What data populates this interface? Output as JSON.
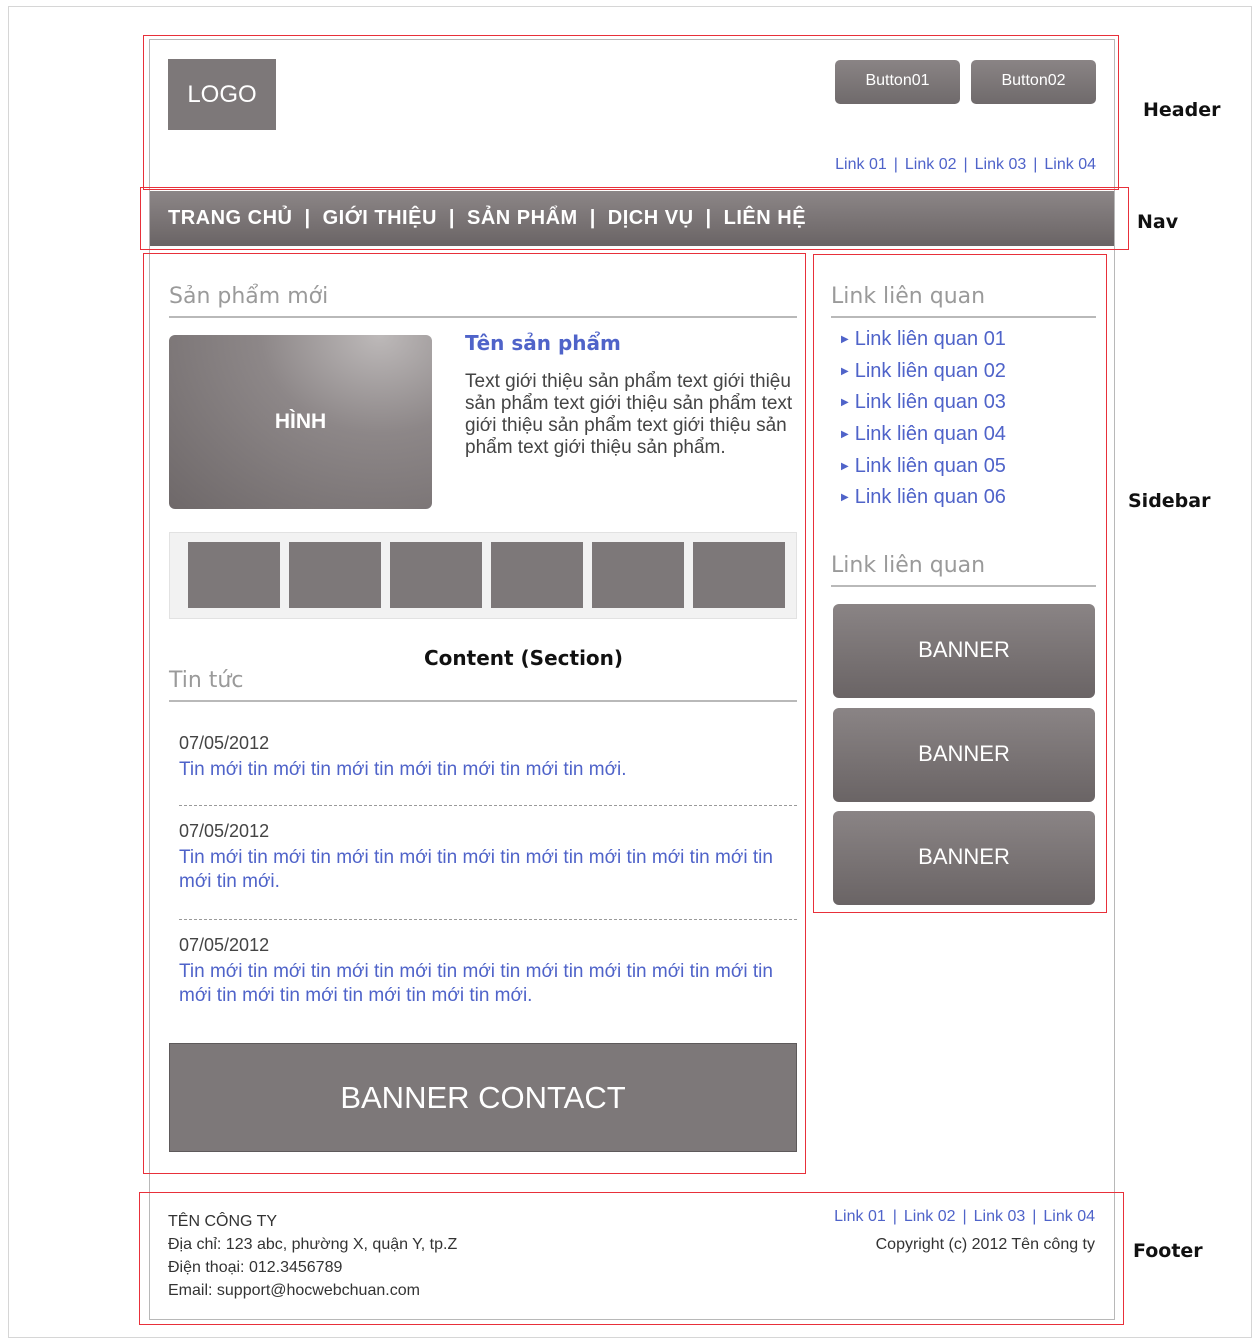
{
  "header": {
    "logo": "LOGO",
    "button1": "Button01",
    "button2": "Button02",
    "links": [
      "Link 01",
      "Link 02",
      "Link 03",
      "Link 04"
    ],
    "separator": "|"
  },
  "nav": {
    "items": [
      "TRANG CHỦ",
      "GIỚI THIỆU",
      "SẢN PHẨM",
      "DỊCH VỤ",
      "LIÊN HỆ"
    ],
    "separator": "|"
  },
  "content": {
    "new_products_title": "Sản phẩm mới",
    "product_image_label": "HÌNH",
    "product_name": "Tên sản phẩm",
    "product_desc": "Text giới thiệu sản phẩm text giới thiệu sản phẩm text giới thiệu sản phẩm text giới thiệu sản phẩm text giới thiệu sản phẩm text giới thiệu sản phẩm.",
    "thumbnail_count": 6,
    "section_caption": "Content (Section)",
    "news_title": "Tin tức",
    "news": [
      {
        "date": "07/05/2012",
        "text": "Tin mới tin mới tin mới tin mới tin mới tin mới tin mới."
      },
      {
        "date": "07/05/2012",
        "text": "Tin mới tin mới tin mới tin mới tin mới tin mới tin mới tin mới tin mới tin mới tin mới."
      },
      {
        "date": "07/05/2012",
        "text": "Tin mới tin mới tin mới tin mới tin mới tin mới tin mới tin mới tin mới tin mới tin mới tin mới tin mới tin mới tin mới."
      }
    ],
    "contact_banner": "BANNER CONTACT"
  },
  "sidebar": {
    "links_title": "Link liên quan",
    "links": [
      "Link liên quan 01",
      "Link liên quan 02",
      "Link liên quan 03",
      "Link liên quan 04",
      "Link liên quan 05",
      "Link liên quan 06"
    ],
    "banners_title": "Link liên quan",
    "banners": [
      "BANNER",
      "BANNER",
      "BANNER"
    ]
  },
  "footer": {
    "company": "TÊN CÔNG TY",
    "address": "Địa chỉ: 123 abc, phường X, quận Y, tp.Z",
    "phone": "Điện thoại: 012.3456789",
    "email": "Email: support@hocwebchuan.com",
    "links": [
      "Link 01",
      "Link 02",
      "Link 03",
      "Link 04"
    ],
    "copyright": "Copyright (c) 2012 Tên công ty"
  },
  "zone_labels": {
    "header": "Header",
    "nav": "Nav",
    "sidebar": "Sidebar",
    "footer": "Footer"
  },
  "colors": {
    "accent_link": "#4f63c9",
    "block_gray": "#7d7879",
    "annotation_red": "#e8303a"
  }
}
